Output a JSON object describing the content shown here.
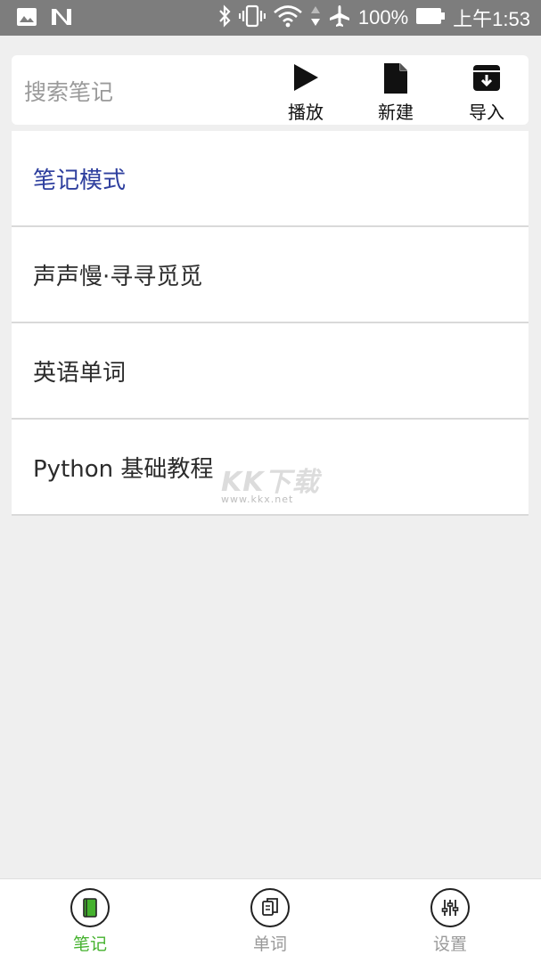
{
  "status_bar": {
    "battery": "100%",
    "time": "上午1:53",
    "icons": [
      "image-icon",
      "n-icon",
      "bluetooth-icon",
      "vibrate-icon",
      "wifi-icon",
      "airplane-icon",
      "battery-icon"
    ]
  },
  "toolbar": {
    "search_placeholder": "搜索笔记",
    "play_label": "播放",
    "new_label": "新建",
    "import_label": "导入"
  },
  "notes": {
    "items": [
      {
        "label": "笔记模式",
        "selected": true
      },
      {
        "label": "声声慢·寻寻觅觅",
        "selected": false
      },
      {
        "label": "英语单词",
        "selected": false
      },
      {
        "label": "Python 基础教程",
        "selected": false
      }
    ]
  },
  "watermark": {
    "text": "KK下载",
    "url": "www.kkx.net"
  },
  "bottom_nav": {
    "items": [
      {
        "label": "笔记",
        "icon": "notebook-icon",
        "active": true
      },
      {
        "label": "单词",
        "icon": "copy-icon",
        "active": false
      },
      {
        "label": "设置",
        "icon": "sliders-icon",
        "active": false
      }
    ]
  },
  "colors": {
    "status_bar_bg": "#7d7d7d",
    "selected_text": "#2e3f9e",
    "active_nav": "#45b22e",
    "background": "#efefef"
  }
}
